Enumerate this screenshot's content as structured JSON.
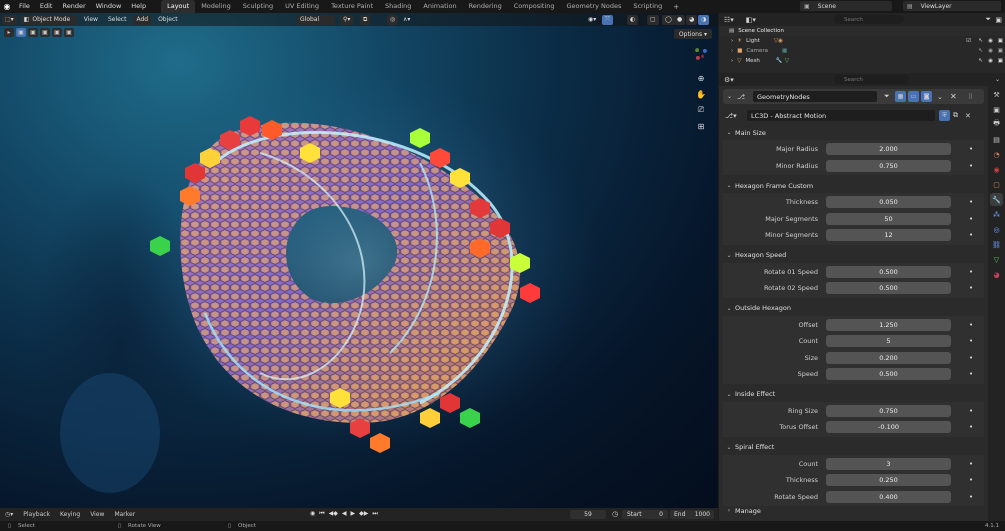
{
  "topbar": {
    "menus": [
      "File",
      "Edit",
      "Render",
      "Window",
      "Help"
    ],
    "workspaces": [
      "Layout",
      "Modeling",
      "Sculpting",
      "UV Editing",
      "Texture Paint",
      "Shading",
      "Animation",
      "Rendering",
      "Compositing",
      "Geometry Nodes",
      "Scripting"
    ],
    "active_workspace": "Layout",
    "scene": "Scene",
    "view_layer": "ViewLayer"
  },
  "viewport": {
    "mode": "Object Mode",
    "menus": [
      "View",
      "Select",
      "Add",
      "Object"
    ],
    "transform_orientation": "Global",
    "options_label": "Options"
  },
  "timeline": {
    "menus": [
      "Playback",
      "Keying",
      "View",
      "Marker"
    ],
    "current_frame": "59",
    "start_label": "Start",
    "start_value": "0",
    "end_label": "End",
    "end_value": "1000"
  },
  "statusbar": {
    "select": "Select",
    "rotate": "Rotate View",
    "object": "Object",
    "version": "4.1.1"
  },
  "outliner": {
    "search_placeholder": "Search",
    "collection": "Scene Collection",
    "items": [
      {
        "name": "Light"
      },
      {
        "name": "Camera"
      },
      {
        "name": "Mesh"
      }
    ]
  },
  "properties": {
    "search_placeholder": "Search",
    "modifier_name": "GeometryNodes",
    "node_group": "LC3D - Abstract Motion",
    "sections": [
      {
        "title": "Main Size",
        "params": [
          {
            "label": "Major Radius",
            "value": "2.000"
          },
          {
            "label": "Minor Radius",
            "value": "0.750"
          }
        ]
      },
      {
        "title": "Hexagon Frame Custom",
        "params": [
          {
            "label": "Thickness",
            "value": "0.050"
          },
          {
            "label": "Major Segments",
            "value": "50"
          },
          {
            "label": "Minor Segments",
            "value": "12"
          }
        ]
      },
      {
        "title": "Hexagon Speed",
        "params": [
          {
            "label": "Rotate 01 Speed",
            "value": "0.500"
          },
          {
            "label": "Rotate 02 Speed",
            "value": "0.500"
          }
        ]
      },
      {
        "title": "Outside Hexagon",
        "params": [
          {
            "label": "Offset",
            "value": "1.250"
          },
          {
            "label": "Count",
            "value": "5"
          },
          {
            "label": "Size",
            "value": "0.200"
          },
          {
            "label": "Speed",
            "value": "0.500"
          }
        ]
      },
      {
        "title": "Inside Effect",
        "params": [
          {
            "label": "Ring Size",
            "value": "0.750"
          },
          {
            "label": "Torus Offset",
            "value": "-0.100"
          }
        ]
      },
      {
        "title": "Spiral Effect",
        "params": [
          {
            "label": "Count",
            "value": "3"
          },
          {
            "label": "Thickness",
            "value": "0.250"
          },
          {
            "label": "Rotate Speed",
            "value": "0.400"
          }
        ]
      }
    ],
    "manage_label": "Manage"
  },
  "colors": {
    "accent": "#4772b3",
    "field": "#545454",
    "panel": "#2b2b2b"
  }
}
